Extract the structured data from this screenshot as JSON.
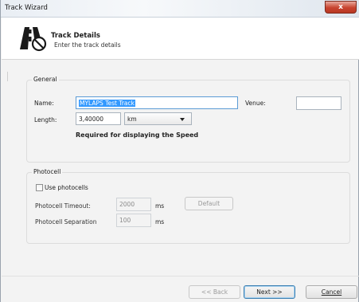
{
  "window": {
    "title": "Track Wizard",
    "close_label": "x"
  },
  "header": {
    "title": "Track Details",
    "subtitle": "Enter the track details",
    "icon": "road-no-entry-icon"
  },
  "general": {
    "legend": "General",
    "name_label": "Name:",
    "name_value": "MYLAPS Test Track",
    "venue_label": "Venue:",
    "venue_value": "",
    "length_label": "Length:",
    "length_value": "3,40000",
    "unit_selected": "km",
    "speed_note": "Required for displaying the Speed"
  },
  "photocell": {
    "legend": "Photocell",
    "use_label": "Use photocells",
    "use_checked": false,
    "timeout_label": "Photocell Timeout:",
    "timeout_value": "2000",
    "timeout_unit": "ms",
    "default_label": "Default",
    "separation_label": "Photocell Separation",
    "separation_value": "100",
    "separation_unit": "ms"
  },
  "footer": {
    "back_label": "<< Back",
    "next_label": "Next >>",
    "cancel_label": "Cancel"
  },
  "colors": {
    "selection": "#3399ff",
    "close_button": "#c8442f"
  }
}
